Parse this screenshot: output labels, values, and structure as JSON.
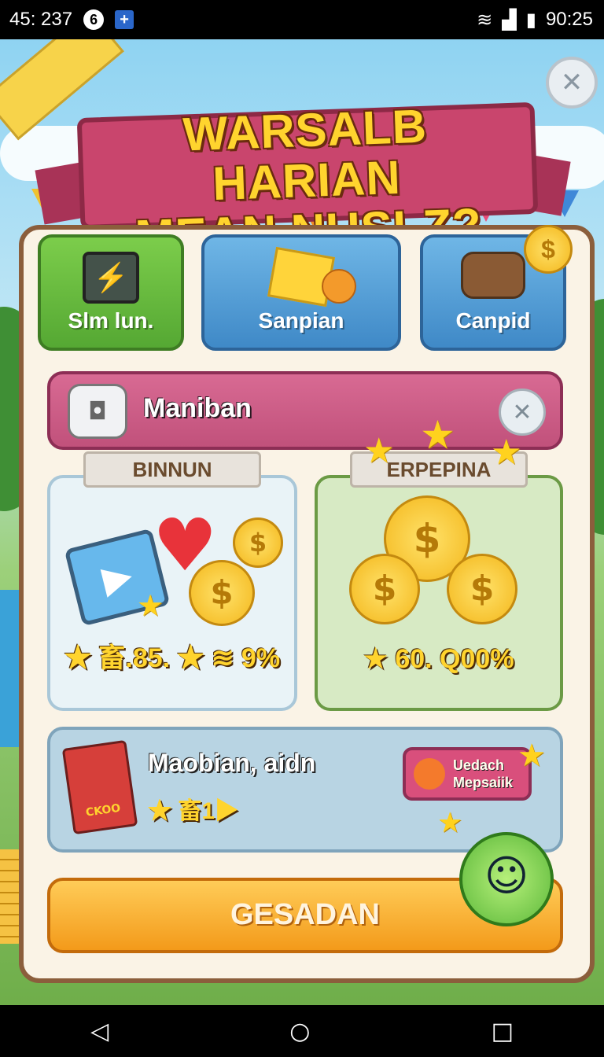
{
  "status_bar": {
    "time_left": "45: 237",
    "notif_badge": "6",
    "notif_plus": "+",
    "clock": "90:25"
  },
  "header": {
    "title_line1": "WARSALB HARIAN",
    "title_line2": "MEAN NUSLZ?"
  },
  "tabs": [
    {
      "label": "Slm lun."
    },
    {
      "label": "Sanpian"
    },
    {
      "label": "Canpid"
    }
  ],
  "section": {
    "label": "Maniban"
  },
  "cards": {
    "left": {
      "tag": "BINNUN",
      "value": "★ 畜.85. ★ ≋ 9%"
    },
    "right": {
      "tag": "ERPEPINA",
      "value": "★ 60. Q00%"
    }
  },
  "gift": {
    "title": "Maobian, aidn",
    "sub": "★ 畜1▶",
    "book_text": "CKOO",
    "button_line1": "Uedach",
    "button_line2": "Mepsaiik"
  },
  "main_button": {
    "label": "GESADAN"
  },
  "icons": {
    "coin": "$",
    "close": "✕",
    "play": "▶",
    "heart": "♥",
    "bolt": "⚡",
    "smile": "☺"
  },
  "colors": {
    "ribbon": "#c9456d",
    "title": "#ffd42e",
    "panel": "#faf3e6",
    "main_button": "#f39a1a"
  }
}
